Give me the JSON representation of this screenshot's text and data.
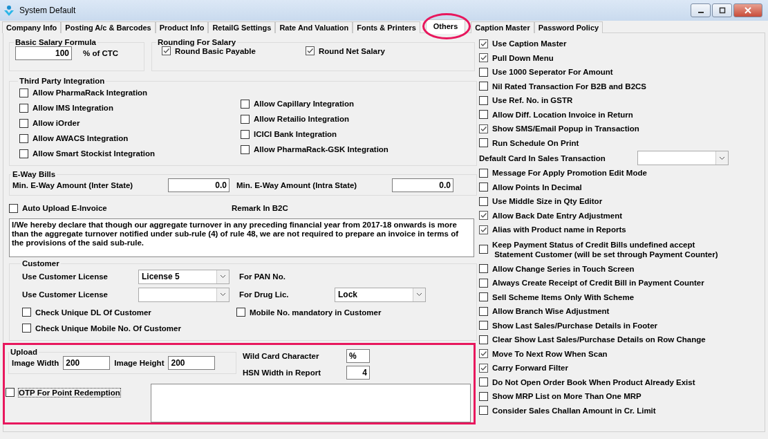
{
  "window": {
    "title": "System Default"
  },
  "tabs": [
    {
      "label": "Company Info",
      "selected": false
    },
    {
      "label": "Posting A/c & Barcodes",
      "selected": false
    },
    {
      "label": "Product Info",
      "selected": false
    },
    {
      "label": "RetailG Settings",
      "selected": false
    },
    {
      "label": "Rate And Valuation",
      "selected": false
    },
    {
      "label": "Fonts & Printers",
      "selected": false
    },
    {
      "label": "Others",
      "selected": true
    },
    {
      "label": "Caption Master",
      "selected": false
    },
    {
      "label": "Password Policy",
      "selected": false
    }
  ],
  "basic_salary": {
    "title": "Basic Salary Formula",
    "value": "100",
    "unit": "% of CTC"
  },
  "rounding": {
    "title": "Rounding For Salary",
    "options": [
      {
        "label": "Round Basic Payable",
        "checked": true
      },
      {
        "label": "Round Net Salary",
        "checked": true
      }
    ]
  },
  "third_party": {
    "title": "Third Party Integration",
    "left": [
      {
        "label": "Allow PharmaRack Integration",
        "checked": false
      },
      {
        "label": "Allow IMS Integration",
        "checked": false
      },
      {
        "label": "Allow iOrder",
        "checked": false
      },
      {
        "label": "Allow AWACS Integration",
        "checked": false
      },
      {
        "label": "Allow Smart Stockist Integration",
        "checked": false
      }
    ],
    "right": [
      {
        "label": "Allow Capillary Integration",
        "checked": false
      },
      {
        "label": "Allow Retailio Integration",
        "checked": false
      },
      {
        "label": "ICICI Bank Integration",
        "checked": false
      },
      {
        "label": "Allow PharmaRack-GSK Integration",
        "checked": false
      }
    ]
  },
  "eway": {
    "title": "E-Way Bills",
    "fields": [
      {
        "label": "Min. E-Way Amount (Inter State)",
        "value": "0.0"
      },
      {
        "label": "Min. E-Way Amount (Intra State)",
        "value": "0.0"
      }
    ]
  },
  "auto_upload": {
    "label": "Auto Upload E-Invoice",
    "checked": false
  },
  "remark_label": "Remark In B2C",
  "declaration": "I/We hereby declare that though our aggregate turnover in any preceding financial year from 2017-18 onwards is more than the aggregate turnover notified under sub-rule (4) of rule 48, we are not required to prepare an invoice in terms of the provisions of the said sub-rule.",
  "customer": {
    "title": "Customer",
    "rows": [
      {
        "label": "Use Customer License",
        "value": "License 5",
        "side_label": "For PAN No."
      },
      {
        "label": "Use Customer License",
        "side_label": "For Drug Lic.",
        "side_value": "Lock"
      }
    ],
    "checks": [
      {
        "label": "Check Unique DL Of Customer",
        "checked": false
      },
      {
        "label": "Mobile No. mandatory in Customer",
        "checked": false
      },
      {
        "label": "Check Unique Mobile No. Of Customer",
        "checked": false
      }
    ]
  },
  "upload": {
    "title": "Upload",
    "fields": [
      {
        "label": "Image Width",
        "value": "200"
      },
      {
        "label": "Image Height",
        "value": "200"
      }
    ]
  },
  "extra_fields": [
    {
      "label": "Wild Card Character",
      "value": "%"
    },
    {
      "label": "HSN Width in Report",
      "value": "4"
    }
  ],
  "otp": {
    "label": "OTP For Point Redemption",
    "checked": false
  },
  "options": [
    {
      "kind": "checkbox",
      "label": "Use Caption Master",
      "checked": true
    },
    {
      "kind": "checkbox",
      "label": "Pull Down Menu",
      "checked": true
    },
    {
      "kind": "checkbox",
      "label": "Use 1000 Seperator For Amount",
      "checked": false
    },
    {
      "kind": "checkbox",
      "label": "Nil Rated Transaction For B2B and B2CS",
      "checked": false
    },
    {
      "kind": "checkbox",
      "label": "Use Ref. No. in GSTR",
      "checked": false
    },
    {
      "kind": "checkbox",
      "label": "Allow Diff. Location Invoice in Return",
      "checked": false
    },
    {
      "kind": "checkbox",
      "label": "Show SMS/Email Popup in Transaction",
      "checked": true
    },
    {
      "kind": "checkbox",
      "label": "Run Schedule On Print",
      "checked": false
    },
    {
      "kind": "select",
      "label": "Default Card In Sales Transaction"
    },
    {
      "kind": "checkbox",
      "label": "Message For Apply Promotion Edit Mode",
      "checked": false
    },
    {
      "kind": "checkbox",
      "label": "Allow Points In Decimal",
      "checked": false
    },
    {
      "kind": "checkbox",
      "label": "Use Middle Size in Qty Editor",
      "checked": false
    },
    {
      "kind": "checkbox",
      "label": "Allow Back Date Entry Adjustment",
      "checked": true
    },
    {
      "kind": "checkbox",
      "label": "Alias with Product name in Reports",
      "checked": true
    },
    {
      "kind": "checkbox",
      "label": "Keep Payment Status of Credit Bills undefined accept\n Statement Customer (will be set through Payment Counter)",
      "checked": false
    },
    {
      "kind": "checkbox",
      "label": "Allow Change Series in Touch Screen",
      "checked": false
    },
    {
      "kind": "checkbox",
      "label": "Always Create Receipt of Credit Bill in Payment Counter",
      "checked": false
    },
    {
      "kind": "checkbox",
      "label": "Sell Scheme Items Only With Scheme",
      "checked": false
    },
    {
      "kind": "checkbox",
      "label": "Allow Branch Wise Adjustment",
      "checked": false
    },
    {
      "kind": "checkbox",
      "label": "Show Last Sales/Purchase Details in Footer",
      "checked": false
    },
    {
      "kind": "checkbox",
      "label": "Clear Show Last Sales/Purchase Details on Row Change",
      "checked": false
    },
    {
      "kind": "checkbox",
      "label": "Move To Next Row When Scan",
      "checked": true
    },
    {
      "kind": "checkbox",
      "label": "Carry Forward Filter",
      "checked": true
    },
    {
      "kind": "checkbox",
      "label": "Do Not Open Order Book When Product Already Exist",
      "checked": false
    },
    {
      "kind": "checkbox",
      "label": "Show MRP List on More Than One MRP",
      "checked": false
    },
    {
      "kind": "checkbox",
      "label": "Consider Sales Challan Amount in Cr. Limit",
      "checked": false
    }
  ]
}
